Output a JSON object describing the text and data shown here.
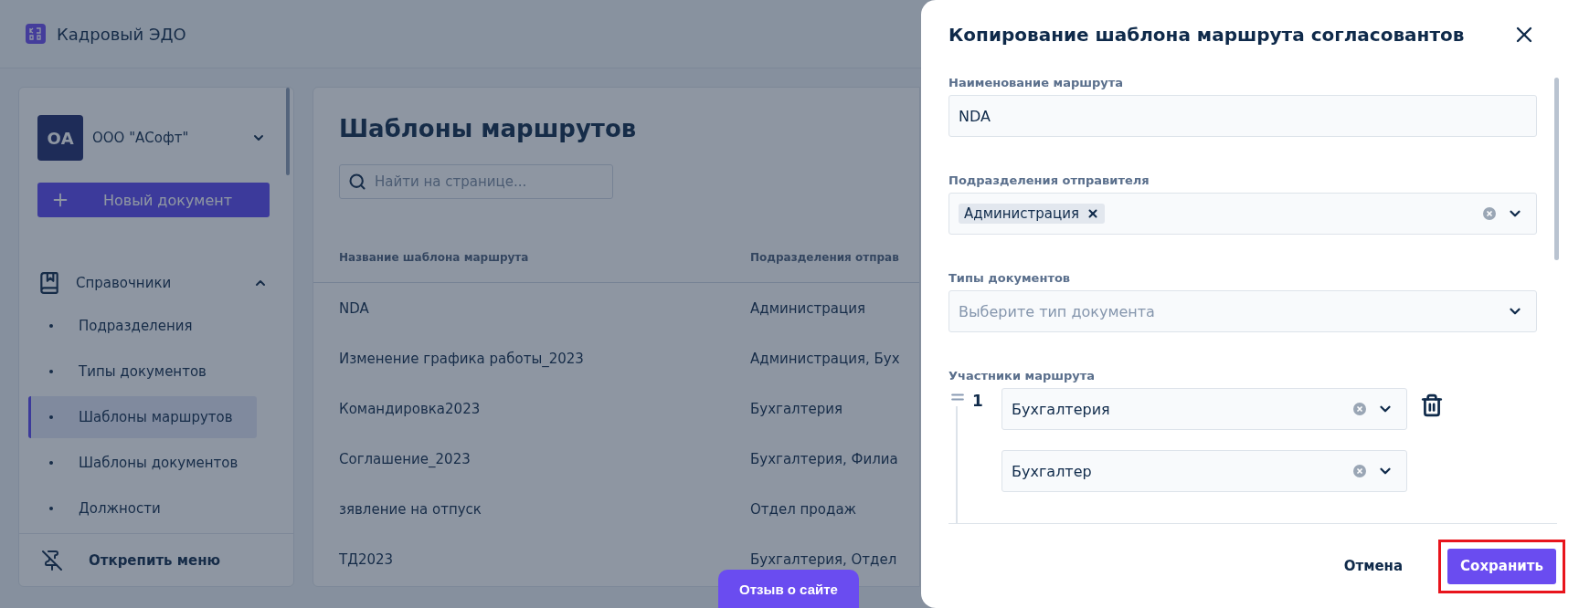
{
  "app": {
    "title": "Кадровый ЭДО"
  },
  "sidebar": {
    "org": {
      "initials": "ОА",
      "name": "ООО \"АСофт\""
    },
    "new_button": "Новый документ",
    "section": {
      "label": "Справочники",
      "expanded": true,
      "items": [
        {
          "label": "Подразделения",
          "selected": false
        },
        {
          "label": "Типы документов",
          "selected": false
        },
        {
          "label": "Шаблоны маршрутов",
          "selected": true
        },
        {
          "label": "Шаблоны документов",
          "selected": false
        },
        {
          "label": "Должности",
          "selected": false
        }
      ]
    },
    "unpin": "Открепить меню"
  },
  "page": {
    "title": "Шаблоны маршрутов",
    "search": {
      "placeholder": "Найти на странице..."
    },
    "table": {
      "columns": [
        "Название шаблона маршрута",
        "Подразделения отправ"
      ],
      "rows": [
        [
          "NDA",
          "Администрация"
        ],
        [
          "Изменение графика работы_2023",
          "Администрация, Бух"
        ],
        [
          "Командировка2023",
          "Бухгалтерия"
        ],
        [
          "Соглашение_2023",
          "Бухгалтерия, Филиа"
        ],
        [
          "зявление на отпуск",
          "Отдел продаж"
        ],
        [
          "ТД2023",
          "Бухгалтерия, Отдел"
        ]
      ]
    }
  },
  "feedback_button": "Отзыв о сайте",
  "dialog": {
    "title": "Копирование шаблона маршрута согласовантов",
    "fields": [
      {
        "kind": "text",
        "label": "Наименование маршрута",
        "value": "NDA"
      },
      {
        "kind": "multiselect",
        "label": "Подразделения отправителя",
        "tags": [
          "Администрация"
        ]
      },
      {
        "kind": "select",
        "label": "Типы документов",
        "placeholder": "Выберите тип документа"
      }
    ],
    "participants": {
      "label": "Участники маршрута",
      "steps": [
        {
          "number": "1",
          "department": "Бухгалтерия",
          "position": "Бухгалтер"
        }
      ]
    },
    "buttons": [
      {
        "label": "Отмена",
        "kind": "secondary",
        "highlighted": false
      },
      {
        "label": "Сохранить",
        "kind": "primary",
        "highlighted": true
      }
    ]
  }
}
